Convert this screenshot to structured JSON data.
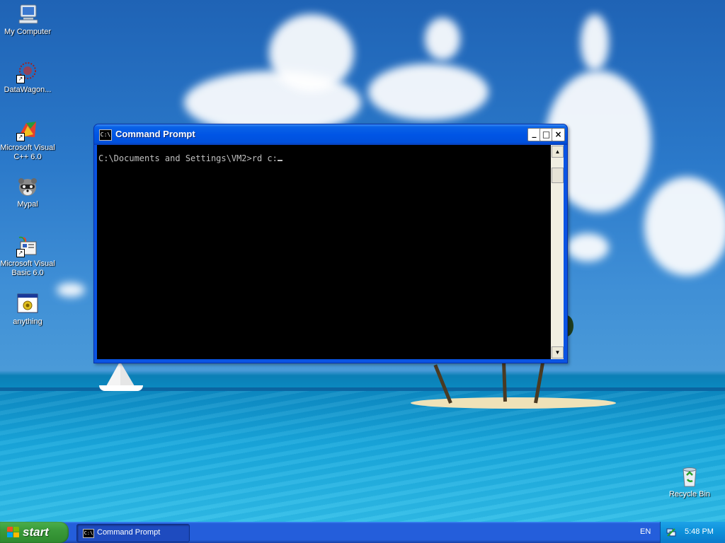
{
  "desktop": {
    "icons": [
      {
        "label": "My Computer",
        "icon": "my-computer-icon"
      },
      {
        "label": "DataWagon...",
        "icon": "datawagon-icon"
      },
      {
        "label": "Microsoft Visual C++ 6.0",
        "icon": "visual-cpp-icon"
      },
      {
        "label": "Mypal",
        "icon": "mypal-raccoon-icon"
      },
      {
        "label": "Microsoft Visual Basic 6.0",
        "icon": "visual-basic-icon"
      },
      {
        "label": "anything",
        "icon": "application-icon"
      },
      {
        "label": "Recycle Bin",
        "icon": "recycle-bin-icon"
      }
    ]
  },
  "window": {
    "title": "Command Prompt",
    "icon_text": "C:\\",
    "minimize_glyph": "_",
    "maximize_glyph": "□",
    "close_glyph": "×",
    "console_line": "C:\\Documents and Settings\\VM2>rd c:"
  },
  "scrollbar": {
    "up_glyph": "▲",
    "down_glyph": "▼"
  },
  "taskbar": {
    "start_label": "start",
    "task_label": "Command Prompt",
    "task_icon_text": "C:\\",
    "language": "EN",
    "clock": "5:48 PM"
  },
  "colors": {
    "console_bg": "#000000",
    "console_text": "#c0c0c0",
    "titlebar": "#0055e5",
    "taskbar": "#245edb",
    "start_button": "#3a9a3a"
  }
}
